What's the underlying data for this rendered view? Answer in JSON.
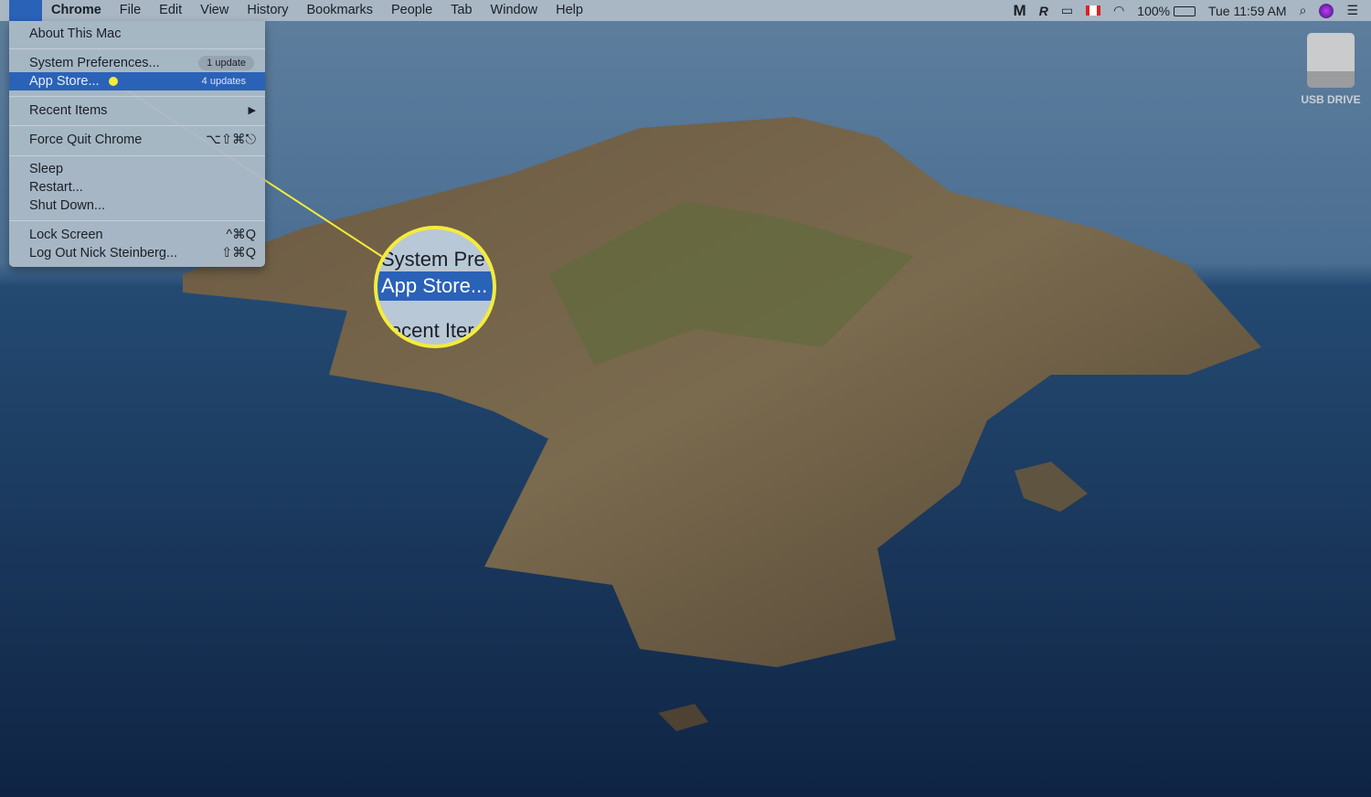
{
  "menubar": {
    "apple_icon": "apple-logo",
    "app": "Chrome",
    "items": [
      "File",
      "Edit",
      "View",
      "History",
      "Bookmarks",
      "People",
      "Tab",
      "Window",
      "Help"
    ],
    "status": {
      "battery": "100%",
      "clock": "Tue 11:59 AM",
      "icons": [
        "malwarebytes-icon",
        "app-icon",
        "airplay-icon",
        "canada-flag-icon",
        "wifi-icon",
        "battery-charging-icon",
        "search-icon",
        "siri-icon",
        "notification-center-icon"
      ]
    }
  },
  "apple_menu": {
    "about": "About This Mac",
    "sysprefs": "System Preferences...",
    "sysprefs_badge": "1 update",
    "appstore": "App Store...",
    "appstore_badge": "4 updates",
    "recent": "Recent Items",
    "forcequit": "Force Quit Chrome",
    "forcequit_sc": "⌥⇧⌘⎋",
    "sleep": "Sleep",
    "restart": "Restart...",
    "shutdown": "Shut Down...",
    "lock": "Lock Screen",
    "lock_sc": "^⌘Q",
    "logout": "Log Out Nick Steinberg...",
    "logout_sc": "⇧⌘Q"
  },
  "magnifier": {
    "line1": "System Pre",
    "line2": "App Store...",
    "line3": "Recent Iter",
    "color": "#f4ec3a"
  },
  "desktop": {
    "usb_label": "USB DRIVE"
  }
}
